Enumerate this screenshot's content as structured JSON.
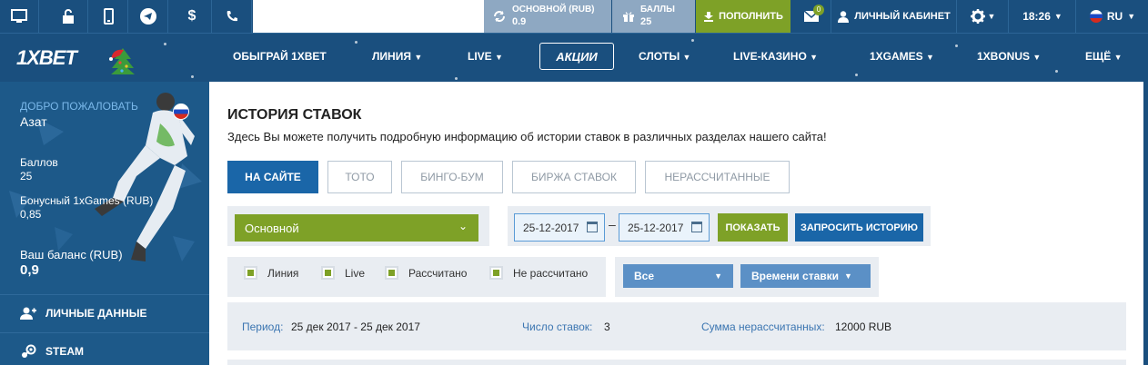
{
  "topbar": {
    "account_label": "ОСНОВНОЙ (RUB)",
    "account_value": "0.9",
    "points_label": "БАЛЛЫ",
    "points_value": "25",
    "deposit_label": "ПОПОЛНИТЬ",
    "mail_count": "0",
    "cabinet_label": "ЛИЧНЫЙ КАБИНЕТ",
    "time": "18:26",
    "language": "RU"
  },
  "nav": {
    "logo": "1XBET",
    "items": [
      "ОБЫГРАЙ 1XBET",
      "ЛИНИЯ",
      "LIVE",
      "АКЦИИ",
      "СЛОТЫ",
      "LIVE-КАЗИНО",
      "1XGAMES",
      "1XBONUS",
      "ЕЩЁ"
    ]
  },
  "sidebar": {
    "welcome": "ДОБРО ПОЖАЛОВАТЬ",
    "username": "Азат",
    "points_label": "Баллов",
    "points_value": "25",
    "bonus_label": "Бонусный 1xGames (RUB)",
    "bonus_value": "0,85",
    "balance_label": "Ваш баланс (RUB)",
    "balance_value": "0,9",
    "links": [
      "ЛИЧНЫЕ ДАННЫЕ",
      "STEAM"
    ]
  },
  "main": {
    "title": "ИСТОРИЯ СТАВОК",
    "description": "Здесь Вы можете получить подробную информацию об истории ставок в различных разделах нашего сайта!",
    "tabs": [
      "НА САЙТЕ",
      "ТОТО",
      "БИНГО-БУМ",
      "БИРЖА СТАВОК",
      "НЕРАССЧИТАННЫЕ"
    ],
    "account_select": "Основной",
    "date_from": "25-12-2017",
    "date_to": "25-12-2017",
    "date_separator": "–",
    "show_button": "ПОКАЗАТЬ",
    "request_button": "ЗАПРОСИТЬ ИСТОРИЮ",
    "checkboxes": [
      "Линия",
      "Live",
      "Рассчитано",
      "Не рассчитано"
    ],
    "type_select": "Все",
    "sort_select": "Времени ставки",
    "summary": {
      "period_label": "Период:",
      "period_value": "25 дек 2017 - 25 дек 2017",
      "count_label": "Число ставок:",
      "count_value": "3",
      "sum_label": "Сумма нерассчитанных:",
      "sum_value": "12000 RUB"
    }
  },
  "colors": {
    "header_blue": "#1a4f7e",
    "sidebar_blue": "#1d5989",
    "accent_green": "#7ea127",
    "button_blue": "#1a66a8",
    "select_blue": "#5b90c6",
    "panel_gray": "#e9edf2"
  }
}
